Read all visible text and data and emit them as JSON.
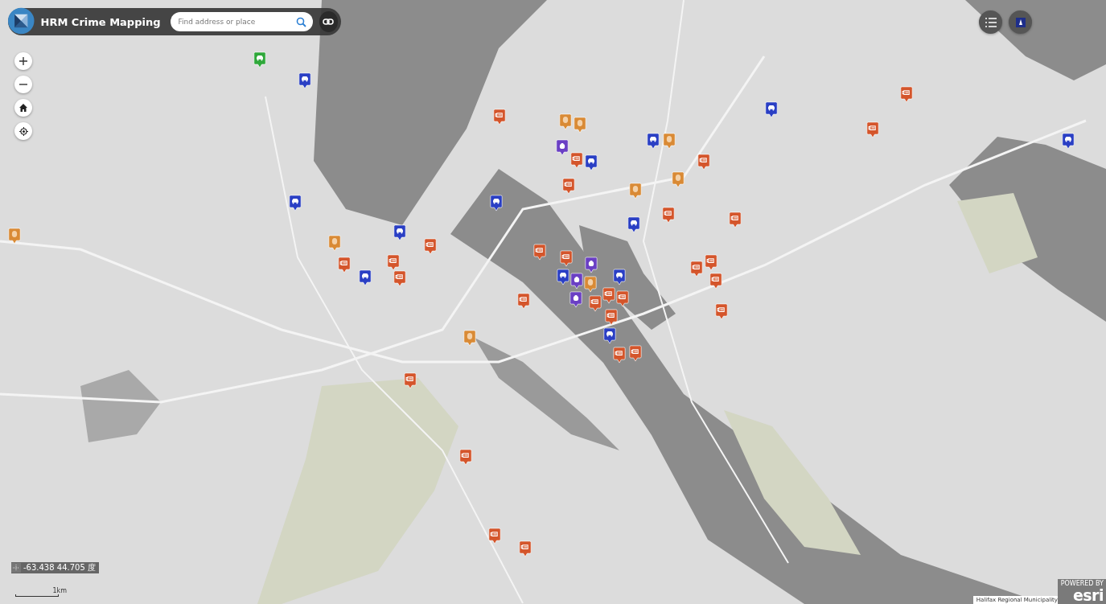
{
  "header": {
    "title": "HRM Crime Mapping",
    "search": {
      "placeholder": "Find address or place"
    }
  },
  "coordinates": {
    "text": "-63.438 44.705 度"
  },
  "scale_bar": {
    "label": "1km"
  },
  "attribution": "Halifax Regional Municipality",
  "esri": {
    "powered": "POWERED BY",
    "logo": "esri"
  },
  "pins": [
    {
      "kind": "hand",
      "color": "#d4552b"
    },
    {
      "kind": "hand",
      "color": "#d4552b"
    },
    {
      "kind": "hand",
      "color": "#d4552b"
    },
    {
      "kind": "hand",
      "color": "#d4552b"
    },
    {
      "kind": "hand",
      "color": "#d4552b"
    },
    {
      "kind": "hand",
      "color": "#d4552b"
    },
    {
      "kind": "hand",
      "color": "#d4552b"
    },
    {
      "kind": "hand",
      "color": "#d4552b"
    },
    {
      "kind": "hand",
      "color": "#d4552b"
    },
    {
      "kind": "hand",
      "color": "#d4552b"
    },
    {
      "kind": "hand",
      "color": "#d4552b"
    },
    {
      "kind": "hand",
      "color": "#d4552b"
    },
    {
      "kind": "hand",
      "color": "#d4552b"
    },
    {
      "kind": "hand",
      "color": "#d4552b"
    },
    {
      "kind": "hand",
      "color": "#d4552b"
    },
    {
      "kind": "hand",
      "color": "#d4552b"
    },
    {
      "kind": "hand",
      "color": "#d4552b"
    },
    {
      "kind": "hand",
      "color": "#d4552b"
    },
    {
      "kind": "hand",
      "color": "#d4552b"
    },
    {
      "kind": "hand",
      "color": "#d4552b"
    },
    {
      "kind": "hand",
      "color": "#d4552b"
    },
    {
      "kind": "hand",
      "color": "#d4552b"
    },
    {
      "kind": "hand",
      "color": "#d4552b"
    },
    {
      "kind": "hand",
      "color": "#d4552b"
    },
    {
      "kind": "hand",
      "color": "#d4552b"
    },
    {
      "kind": "hand",
      "color": "#d4552b"
    },
    {
      "kind": "hand",
      "color": "#d4552b"
    },
    {
      "kind": "hand",
      "color": "#d4552b"
    },
    {
      "kind": "hand",
      "color": "#d4552b"
    },
    {
      "kind": "face",
      "color": "#d98a35"
    },
    {
      "kind": "face",
      "color": "#d98a35"
    },
    {
      "kind": "face",
      "color": "#d98a35"
    },
    {
      "kind": "face",
      "color": "#d98a35"
    },
    {
      "kind": "face",
      "color": "#d98a35"
    },
    {
      "kind": "face",
      "color": "#d98a35"
    },
    {
      "kind": "face",
      "color": "#d98a35"
    },
    {
      "kind": "face",
      "color": "#d98a35"
    },
    {
      "kind": "face",
      "color": "#d98a35"
    },
    {
      "kind": "car",
      "color": "#2a3fc4"
    },
    {
      "kind": "car",
      "color": "#2a3fc4"
    },
    {
      "kind": "car",
      "color": "#2a3fc4"
    },
    {
      "kind": "car",
      "color": "#2a3fc4"
    },
    {
      "kind": "car",
      "color": "#2a3fc4"
    },
    {
      "kind": "car",
      "color": "#2a3fc4"
    },
    {
      "kind": "car",
      "color": "#2a3fc4"
    },
    {
      "kind": "car",
      "color": "#2a3fc4"
    },
    {
      "kind": "car",
      "color": "#2a3fc4"
    },
    {
      "kind": "car",
      "color": "#2a3fc4"
    },
    {
      "kind": "car",
      "color": "#2a3fc4"
    },
    {
      "kind": "car",
      "color": "#2a3fc4"
    },
    {
      "kind": "car",
      "color": "#2a3fc4"
    },
    {
      "kind": "bag",
      "color": "#6a3fc4"
    },
    {
      "kind": "bag",
      "color": "#6a3fc4"
    },
    {
      "kind": "bag",
      "color": "#6a3fc4"
    },
    {
      "kind": "bag",
      "color": "#6a3fc4"
    },
    {
      "kind": "car",
      "color": "#2fa83a"
    }
  ]
}
